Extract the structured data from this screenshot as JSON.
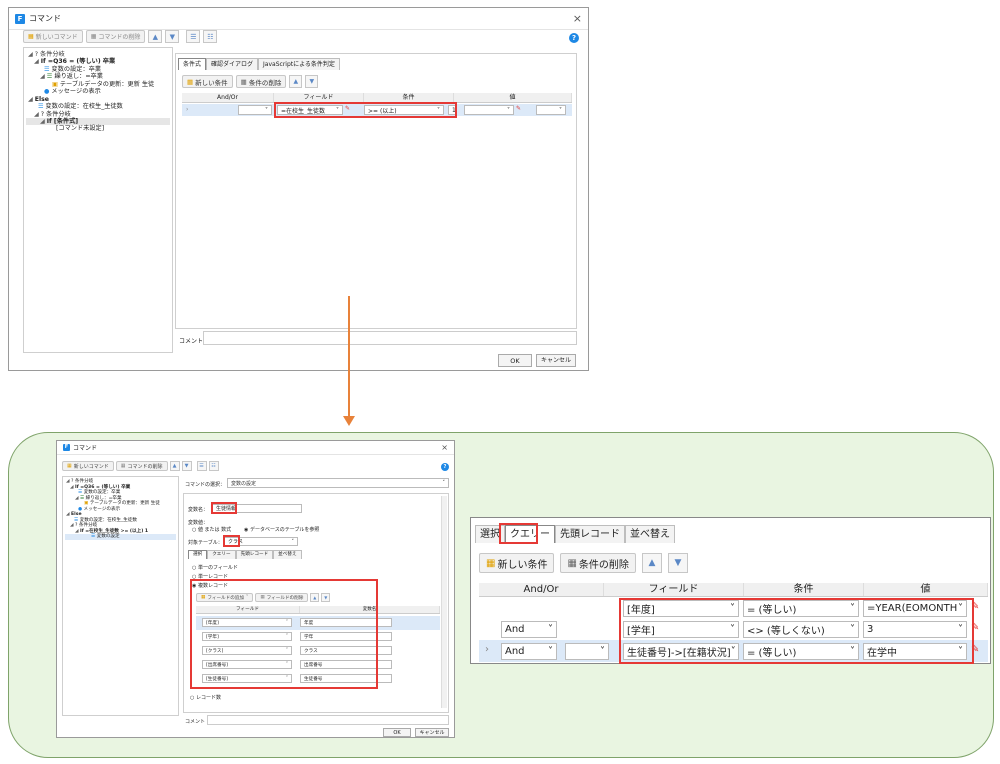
{
  "win1": {
    "title": "コマンド",
    "close": "×",
    "toolbar": {
      "new_command": "新しいコマンド",
      "delete_command": "コマンドの削除"
    },
    "tree": [
      {
        "text": "? 条件分岐",
        "kind": "cond"
      },
      {
        "text": "If  =Q36 = (等しい) 卒業",
        "kind": "if"
      },
      {
        "text": "変数の設定：卒業",
        "kind": "var"
      },
      {
        "text": "繰り返し：=卒業",
        "kind": "loop"
      },
      {
        "text": "テーブルデータの更新：更新 生徒",
        "kind": "table"
      },
      {
        "text": "メッセージの表示",
        "kind": "msg"
      },
      {
        "text": "Else",
        "kind": "else"
      },
      {
        "text": "変数の設定：在校生_生徒数",
        "kind": "var"
      },
      {
        "text": "? 条件分岐",
        "kind": "cond"
      },
      {
        "text": "If  [条件式]",
        "kind": "if"
      },
      {
        "text": "[コマンド未設定]",
        "kind": "none"
      }
    ],
    "tabs": [
      "条件式",
      "確認ダイアログ",
      "JavaScriptによる条件判定"
    ],
    "buttons": {
      "new_condition": "新しい条件",
      "delete_condition": "条件の削除"
    },
    "columns": [
      "And/Or",
      "フィールド",
      "条件",
      "値"
    ],
    "row": {
      "field": "=在校生_生徒数",
      "condition": ">= (以上)",
      "value": "1"
    },
    "comment_label": "コメント",
    "ok": "OK",
    "cancel": "キャンセル"
  },
  "win2": {
    "title": "コマンド",
    "close": "×",
    "toolbar": {
      "new_command": "新しいコマンド",
      "delete_command": "コマンドの削除"
    },
    "tree": [
      {
        "text": "? 条件分岐"
      },
      {
        "text": "If  =Q36 = (等しい) 卒業"
      },
      {
        "text": "変数の設定：卒業"
      },
      {
        "text": "繰り返し：=卒業"
      },
      {
        "text": "テーブルデータの更新：更新 生徒"
      },
      {
        "text": "メッセージの表示"
      },
      {
        "text": "Else"
      },
      {
        "text": "変数の設定：在校生_生徒数"
      },
      {
        "text": "? 条件分岐"
      },
      {
        "text": "If  =在校生_生徒数 >= (以上) 1"
      },
      {
        "text": "変数の設定"
      }
    ],
    "cmd_select_label": "コマンドの選択：",
    "cmd_select_value": "変数の設定",
    "var_name_label": "変数名：",
    "var_name_value": "生徒情報",
    "var_value_label": "変数値：",
    "radio_value": "値 または 数式",
    "radio_db": "データベースのテーブルを参照",
    "target_table_label": "対象テーブル：",
    "target_table_value": "クラス",
    "subtabs": [
      "選択",
      "クエリー",
      "先頭レコード",
      "並べ替え"
    ],
    "opt_single": "単一のフィールド",
    "opt_single_record": "単一レコード",
    "opt_multi": "複数レコード",
    "add_field": "フィールドの追加",
    "delete_field": "フィールドの削除",
    "fieldcols": [
      "フィールド",
      "変数名"
    ],
    "fields": [
      {
        "field": "[年度]",
        "var": "年度"
      },
      {
        "field": "[学年]",
        "var": "学年"
      },
      {
        "field": "[クラス]",
        "var": "クラス"
      },
      {
        "field": "[出席番号]",
        "var": "出席番号"
      },
      {
        "field": "[生徒番号]",
        "var": "生徒番号"
      }
    ],
    "opt_count": "レコード数",
    "comment_label": "コメント",
    "ok": "OK",
    "cancel": "キャンセル"
  },
  "zoom": {
    "tabs": [
      "選択",
      "クエリー",
      "先頭レコード",
      "並べ替え"
    ],
    "buttons": {
      "new_condition": "新しい条件",
      "delete_condition": "条件の削除"
    },
    "columns": [
      "And/Or",
      "フィールド",
      "条件",
      "値"
    ],
    "rows": [
      {
        "andor": "",
        "field": "[年度]",
        "cond": "= (等しい)",
        "value": "=YEAR(EOMONTH"
      },
      {
        "andor": "And",
        "field": "[学年]",
        "cond": "<> (等しくない)",
        "value": "3"
      },
      {
        "andor": "And",
        "field": "生徒番号]->[在籍状況]",
        "cond": "= (等しい)",
        "value": "在学中"
      }
    ]
  }
}
